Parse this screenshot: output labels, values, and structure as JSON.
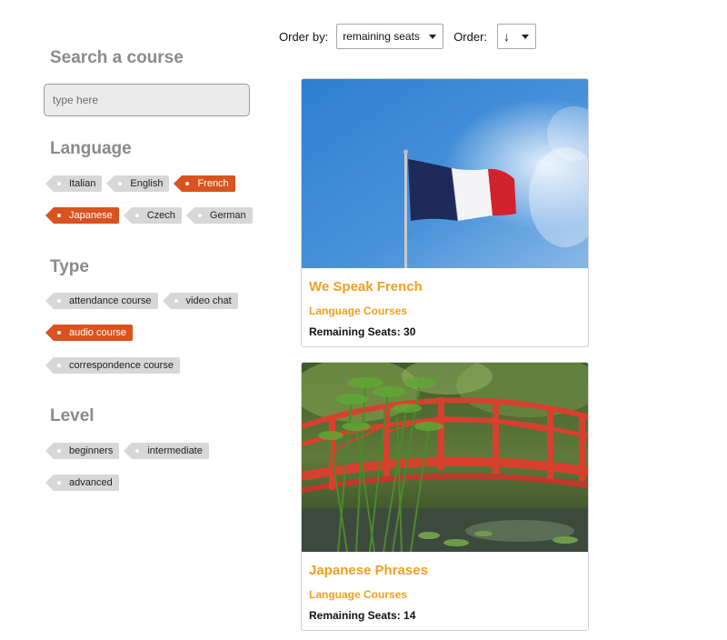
{
  "order": {
    "by_label": "Order by:",
    "by_value": "remaining seats",
    "dir_label": "Order:",
    "dir_value": "↓"
  },
  "search": {
    "title": "Search a course",
    "placeholder": "type here",
    "value": ""
  },
  "filters": {
    "language": {
      "title": "Language",
      "rows": [
        [
          {
            "label": "Italian",
            "active": false
          },
          {
            "label": "English",
            "active": false
          },
          {
            "label": "French",
            "active": true
          }
        ],
        [
          {
            "label": "Japanese",
            "active": true
          },
          {
            "label": "Czech",
            "active": false
          },
          {
            "label": "German",
            "active": false
          }
        ]
      ]
    },
    "type": {
      "title": "Type",
      "rows": [
        [
          {
            "label": "attendance course",
            "active": false
          },
          {
            "label": "video chat",
            "active": false
          }
        ],
        [
          {
            "label": "audio course",
            "active": true
          }
        ],
        [
          {
            "label": "correspondence course",
            "active": false
          }
        ]
      ]
    },
    "level": {
      "title": "Level",
      "rows": [
        [
          {
            "label": "beginners",
            "active": false
          },
          {
            "label": "intermediate",
            "active": false
          }
        ],
        [
          {
            "label": "advanced",
            "active": false
          }
        ]
      ]
    }
  },
  "courses": [
    {
      "title": "We Speak French",
      "category": "Language Courses",
      "seats": "Remaining Seats: 30",
      "image": "french-flag-photo"
    },
    {
      "title": "Japanese Phrases",
      "category": "Language Courses",
      "seats": "Remaining Seats: 14",
      "image": "japanese-bridge-photo"
    }
  ],
  "colors": {
    "accent": "#d9531e",
    "title_gray": "#8a8a8a",
    "course_title": "#f0a020",
    "tag_bg": "#d7d7d7"
  }
}
